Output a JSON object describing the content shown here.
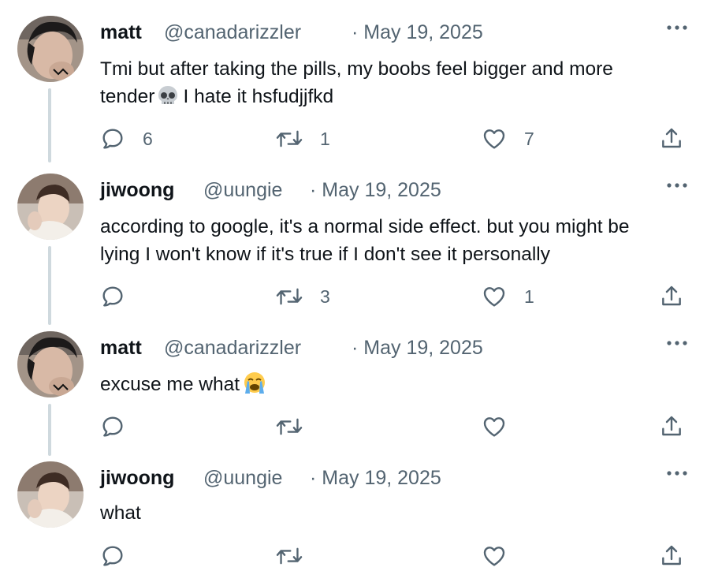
{
  "thread": [
    {
      "name": "matt",
      "handle": "@canadarizzler",
      "date": "· May 19, 2025",
      "text_line1": "Tmi but after taking the pills, my boobs feel bigger and more",
      "text_line2_before": "tender",
      "text_emoji": "skull-emoji",
      "text_line2_after": "I hate it hsfudjjfkd",
      "replies": "6",
      "retweets": "1",
      "likes": "7"
    },
    {
      "name": "jiwoong",
      "handle": "@uungie",
      "date": "· May 19, 2025",
      "text_line1": "according to google, it's a normal side effect. but you might be",
      "text_line2": "lying I won't know if it's true if I don't see it personally",
      "replies": "",
      "retweets": "3",
      "likes": "1"
    },
    {
      "name": "matt",
      "handle": "@canadarizzler",
      "date": "· May 19, 2025",
      "text_line1": "excuse me what",
      "text_emoji": "loudly-crying-emoji",
      "replies": "",
      "retweets": "",
      "likes": ""
    },
    {
      "name": "jiwoong",
      "handle": "@uungie",
      "date": "· May 19, 2025",
      "text_line1": "what",
      "replies": "",
      "retweets": "",
      "likes": ""
    }
  ],
  "icons": {
    "reply": "reply-icon",
    "retweet": "retweet-icon",
    "like": "heart-icon",
    "share": "share-icon",
    "more": "more-icon"
  },
  "colors": {
    "text": "#0f1419",
    "muted": "#536471",
    "thread_line": "#cfd9de"
  }
}
